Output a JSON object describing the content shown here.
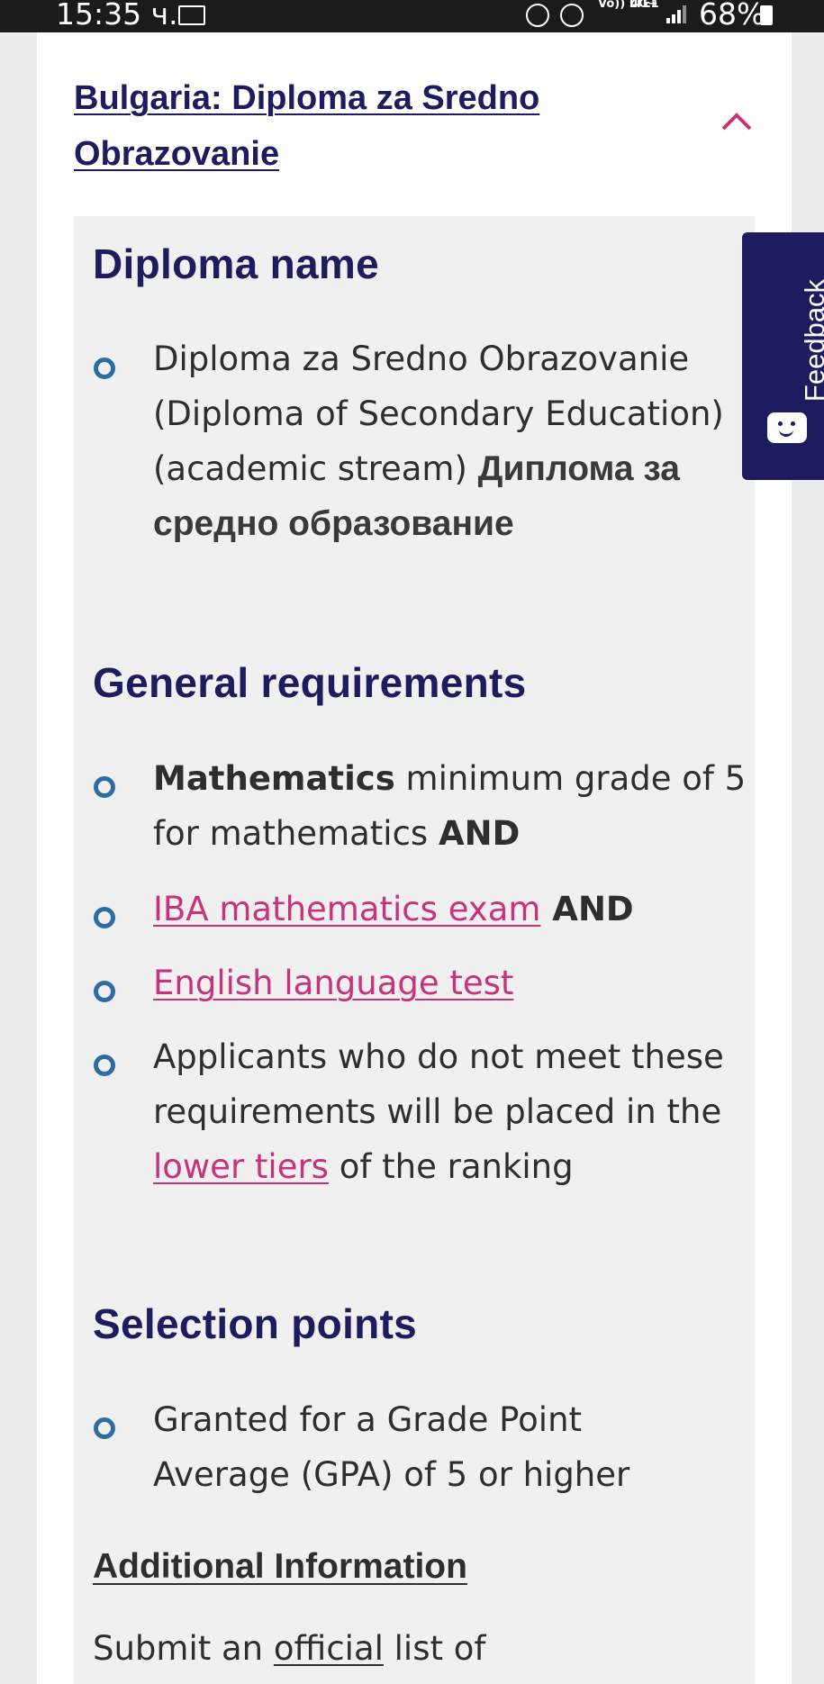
{
  "status_bar": {
    "time": "15:35 ч.",
    "volte": "Vo)) LTE1",
    "network": "4G+",
    "battery": "68%"
  },
  "accordion": {
    "title": "Bulgaria: Diploma za Sredno Obrazovanie",
    "state": "expanded",
    "chevron_icon": "chevron-up-icon",
    "accent_color": "#c8327a"
  },
  "diploma_name": {
    "heading": "Diploma name",
    "items": [
      {
        "text": "Diploma za Sredno Obrazovanie (Diploma of Secondary Education) (academic stream)",
        "native": "Диплома за средно образование"
      }
    ]
  },
  "general_requirements": {
    "heading": "General requirements",
    "math": {
      "bold": "Mathematics",
      "text": " minimum grade of 5 for mathematics ",
      "and": "AND"
    },
    "iba": {
      "link": "IBA mathematics exam",
      "and": " AND"
    },
    "english": {
      "link": "English language test"
    },
    "lower": {
      "pre": "Applicants who do not meet these requirements will be placed in the ",
      "link": "lower tiers",
      "post": " of the ranking"
    }
  },
  "selection_points": {
    "heading": "Selection points",
    "items": [
      "Granted for a Grade Point Average (GPA) of 5 or higher"
    ]
  },
  "additional_info": {
    "heading": "Additional Information",
    "pre": "Submit an ",
    "link": "official",
    "post": " list of"
  },
  "feedback": {
    "label": "Feedback",
    "icon": "smiley-chat-icon"
  },
  "colors": {
    "heading": "#1c1c5e",
    "link": "#c8327a",
    "bullet": "#2e6da4",
    "panel": "#f0f0f0"
  }
}
